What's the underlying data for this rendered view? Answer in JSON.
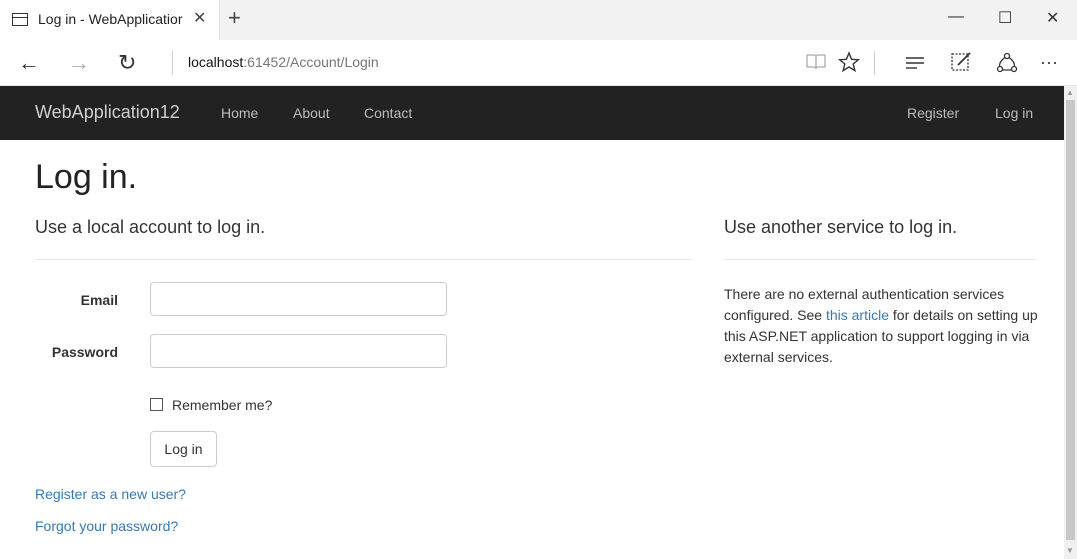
{
  "browser": {
    "tab_title": "Log in - WebApplicatior",
    "tab_close": "✕",
    "new_tab": "+",
    "window": {
      "minimize": "—",
      "maximize": "☐",
      "close": "✕"
    },
    "nav": {
      "back": "←",
      "forward": "→",
      "refresh": "↻"
    },
    "url_host": "localhost",
    "url_rest": ":61452/Account/Login",
    "icons": [
      "reading-view-icon",
      "favorite-star-icon",
      "hub-icon",
      "web-note-icon",
      "share-icon",
      "more-icon"
    ]
  },
  "navbar": {
    "brand": "WebApplication12",
    "links": [
      "Home",
      "About",
      "Contact"
    ],
    "right_links": [
      "Register",
      "Log in"
    ]
  },
  "page": {
    "title": "Log in.",
    "local_heading": "Use a local account to log in.",
    "email_label": "Email",
    "password_label": "Password",
    "remember_label": "Remember me?",
    "login_button": "Log in",
    "register_link": "Register as a new user?",
    "forgot_link": "Forgot your password?",
    "external_heading": "Use another service to log in.",
    "external_text_before": "There are no external authentication services configured. See ",
    "external_link": "this article",
    "external_text_after": " for details on setting up this ASP.NET application to support logging in via external services."
  },
  "colors": {
    "navbar": "#222222",
    "link": "#337ab7"
  }
}
